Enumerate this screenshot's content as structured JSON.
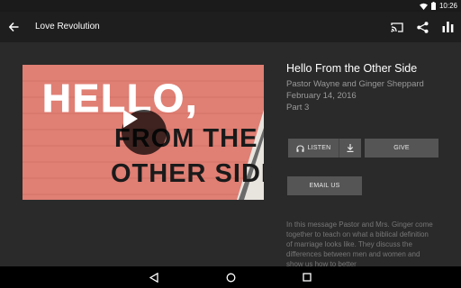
{
  "status_bar": {
    "time": "10:26"
  },
  "app_bar": {
    "title": "Love Revolution"
  },
  "video": {
    "thumbnail_text": [
      "HELLO,",
      "FROM THE",
      "OTHER SIDE"
    ]
  },
  "sermon": {
    "title": "Hello From the Other Side",
    "speaker": "Pastor Wayne and Ginger Sheppard",
    "date": "February 14, 2016",
    "part": "Part 3",
    "description": "In this message Pastor and Mrs. Ginger come together to teach on what a biblical definition of marriage looks like. They discuss the differences between men and women and show us how to better"
  },
  "buttons": {
    "listen": "LISTEN",
    "give": "GIVE",
    "email_us": "EMAIL US"
  },
  "icons": {
    "back": "arrow-back-icon",
    "cast": "cast-icon",
    "share": "share-icon",
    "chart": "bar-chart-icon",
    "play": "play-icon",
    "headphones": "headphones-icon",
    "download": "download-icon",
    "nav_back": "nav-back-icon",
    "nav_home": "nav-home-icon",
    "nav_recents": "nav-recents-icon"
  }
}
